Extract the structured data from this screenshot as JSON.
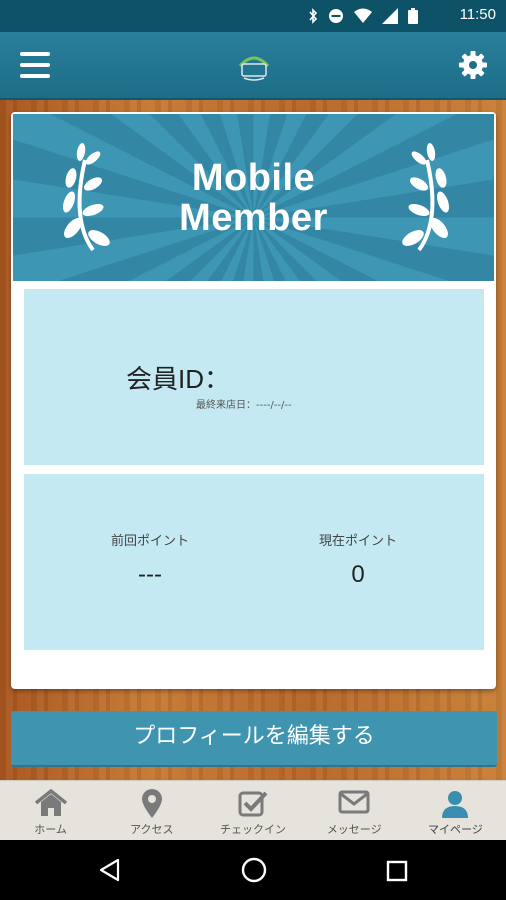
{
  "status_bar": {
    "time": "11:50",
    "icons": [
      "bluetooth-icon",
      "do-not-disturb-icon",
      "wifi-icon",
      "signal-icon",
      "battery-icon"
    ]
  },
  "app_bar": {
    "menu_icon": "hamburger-menu-icon",
    "logo_icon": "shop-logo-icon",
    "settings_icon": "gear-icon"
  },
  "banner": {
    "title_line1": "Mobile",
    "title_line2": "Member"
  },
  "member": {
    "id_label": "会員ID：",
    "last_visit": "最終来店日：----/--/--"
  },
  "points": {
    "previous_label": "前回ポイント",
    "previous_value": "---",
    "current_label": "現在ポイント",
    "current_value": "0"
  },
  "edit_profile_label": "プロフィールを編集する",
  "tabs": [
    {
      "label": "ホーム",
      "icon": "home-icon"
    },
    {
      "label": "アクセス",
      "icon": "map-pin-icon"
    },
    {
      "label": "チェックイン",
      "icon": "checkin-icon"
    },
    {
      "label": "メッセージ",
      "icon": "mail-icon"
    },
    {
      "label": "マイページ",
      "icon": "user-icon"
    }
  ],
  "active_tab": 4,
  "colors": {
    "header": "#1d6d87",
    "panel": "#c4e9f2",
    "button": "#3f95b0",
    "active_tab": "#3a8eb0"
  }
}
